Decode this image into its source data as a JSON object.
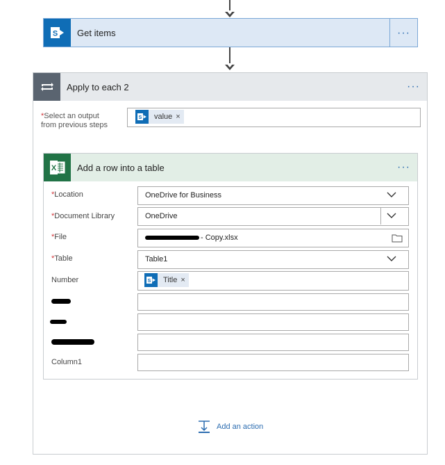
{
  "get_items": {
    "title": "Get items",
    "menu": "···"
  },
  "apply_each": {
    "title": "Apply to each 2",
    "menu": "···",
    "select_label_required": "*",
    "select_label_line1": "Select an output",
    "select_label_line2": "from previous steps",
    "select_token": "value",
    "token_remove": "×"
  },
  "add_row": {
    "title": "Add a row into a table",
    "menu": "···",
    "fields": {
      "location": {
        "required": "*",
        "label": "Location",
        "value": "OneDrive for Business"
      },
      "document_library": {
        "required": "*",
        "label": "Document Library",
        "value": "OneDrive"
      },
      "file": {
        "required": "*",
        "label": "File",
        "value": " - Copy.xlsx"
      },
      "table": {
        "required": "*",
        "label": "Table",
        "value": "Table1"
      },
      "number": {
        "label": "Number",
        "token": "Title",
        "token_remove": "×"
      },
      "column1": {
        "label": "Column1",
        "value": ""
      }
    }
  },
  "add_action": {
    "label": "Add an action"
  },
  "colors": {
    "sharepoint_blue": "#0f6db6",
    "excel_green": "#217346",
    "loop_gray": "#5a6470",
    "link_blue": "#2b6cb0",
    "required_red": "#d13438"
  },
  "icons": [
    "down-arrow-icon",
    "sharepoint-icon",
    "loop-icon",
    "excel-icon",
    "chevron-down-icon",
    "folder-icon",
    "add-action-icon"
  ]
}
